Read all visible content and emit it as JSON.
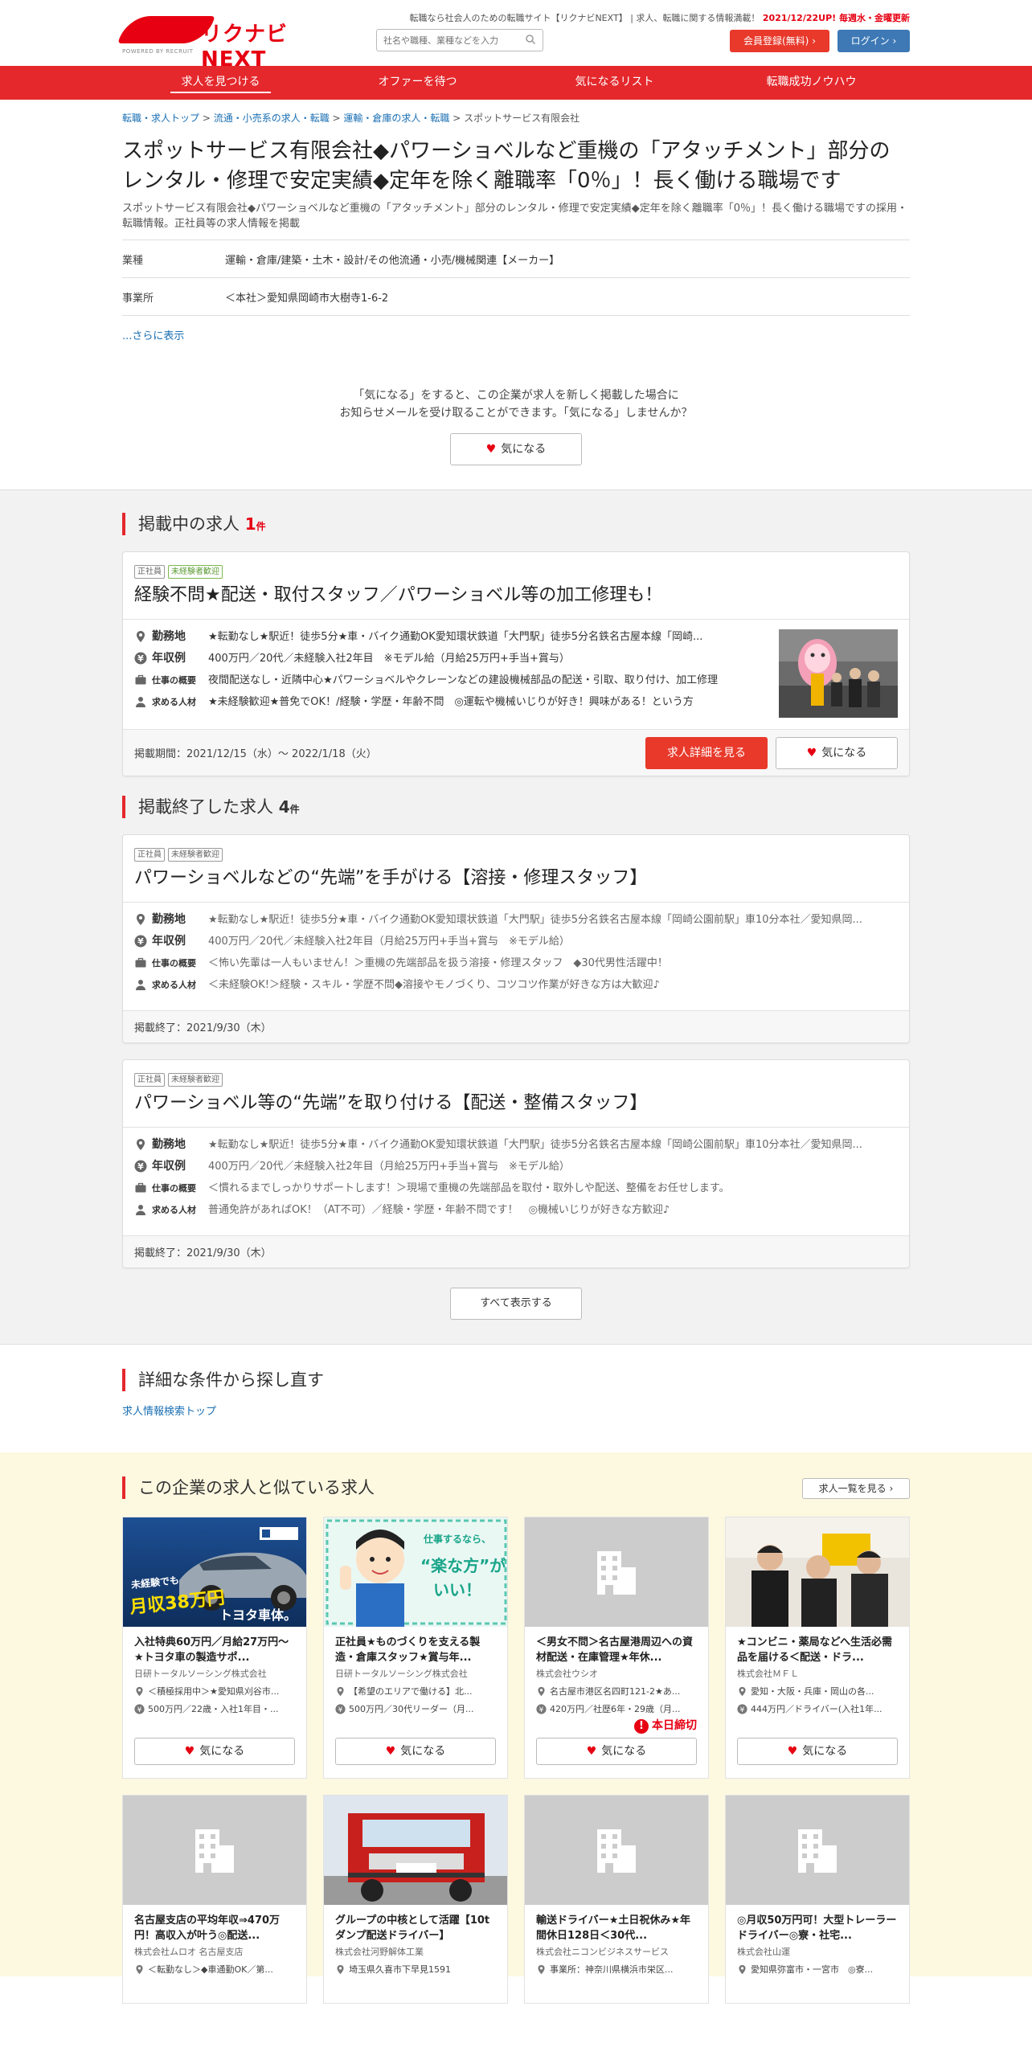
{
  "header": {
    "logo_text": "リクナビNEXT",
    "logo_sub": "POWERED BY RECRUIT",
    "tagline": "転職なら社会人のための転職サイト【リクナビNEXT】 | 求人、転職に関する情報満載！",
    "update_note": "2021/12/22UP! 毎週水・金曜更新",
    "search_placeholder": "社名や職種、業種などを入力",
    "register_label": "会員登録(無料)",
    "login_label": "ログイン"
  },
  "nav": [
    "求人を見つける",
    "オファーを待つ",
    "気になるリスト",
    "転職成功ノウハウ"
  ],
  "breadcrumb": {
    "items": [
      "転職・求人トップ",
      "流通・小売系の求人・転職",
      "運輸・倉庫の求人・転職"
    ],
    "current": "スポットサービス有限会社",
    "sep": " > "
  },
  "company": {
    "title": "スポットサービス有限会社◆パワーショベルなど重機の「アタッチメント」部分のレンタル・修理で安定実績◆定年を除く離職率「0％」！長く働ける職場です",
    "subtitle": "スポットサービス有限会社◆パワーショベルなど重機の「アタッチメント」部分のレンタル・修理で安定実績◆定年を除く離職率「0％」！長く働ける職場ですの採用・転職情報。正社員等の求人情報を掲載",
    "rows": [
      {
        "label": "業種",
        "value": "運輸・倉庫/建築・土木・設計/その他流通・小売/機械関連【メーカー】"
      },
      {
        "label": "事業所",
        "value": "＜本社＞愛知県岡崎市大樹寺1-6-2"
      }
    ],
    "more_label": "...さらに表示"
  },
  "fav_notice": {
    "line1": "「気になる」をすると、この企業が求人を新しく掲載した場合に",
    "line2": "お知らせメールを受け取ることができます。「気になる」しませんか？",
    "button": "気になる"
  },
  "labels": {
    "location": "勤務地",
    "salary": "年収例",
    "summary": "仕事の概要",
    "seeking": "求める人材",
    "detail_button": "求人詳細を見る",
    "fav_button": "気になる",
    "show_all": "すべて表示する",
    "count_unit": "件"
  },
  "active_jobs": {
    "heading": "掲載中の求人",
    "count": "1",
    "jobs": [
      {
        "tags": [
          "正社員",
          "未経験者歓迎"
        ],
        "title": "経験不問★配送・取付スタッフ／パワーショベル等の加工修理も！",
        "location": "★転勤なし★駅近！徒歩5分★車・バイク通勤OK愛知環状鉄道「大門駅」徒歩5分名鉄名古屋本線「岡崎...",
        "salary": "400万円／20代／未経験入社2年目　※モデル給（月給25万円+手当+賞与）",
        "summary": "夜間配送なし・近隣中心★パワーショベルやクレーンなどの建設機械部品の配送・引取、取り付け、加工修理",
        "seeking": "★未経験歓迎★普免でOK！/経験・学歴・年齢不問　◎運転や機械いじりが好き！興味がある！という方",
        "period": "掲載期間：2021/12/15（水）～ 2022/1/18（火）"
      }
    ]
  },
  "ended_jobs": {
    "heading": "掲載終了した求人",
    "count": "4",
    "jobs": [
      {
        "tags": [
          "正社員",
          "未経験者歓迎"
        ],
        "title": "パワーショベルなどの“先端”を手がける【溶接・修理スタッフ】",
        "location": "★転勤なし★駅近！徒歩5分★車・バイク通勤OK愛知環状鉄道「大門駅」徒歩5分名鉄名古屋本線「岡崎公園前駅」車10分本社／愛知県岡...",
        "salary": "400万円／20代／未経験入社2年目（月給25万円+手当+賞与　※モデル給）",
        "summary": "＜怖い先輩は一人もいません！＞重機の先端部品を扱う溶接・修理スタッフ　◆30代男性活躍中！",
        "seeking": "＜未経験OK!＞経験・スキル・学歴不問◆溶接やモノづくり、コツコツ作業が好きな方は大歓迎♪",
        "ended": "掲載終了：2021/9/30（木）"
      },
      {
        "tags": [
          "正社員",
          "未経験者歓迎"
        ],
        "title": "パワーショベル等の“先端”を取り付ける【配送・整備スタッフ】",
        "location": "★転勤なし★駅近！徒歩5分★車・バイク通勤OK愛知環状鉄道「大門駅」徒歩5分名鉄名古屋本線「岡崎公園前駅」車10分本社／愛知県岡...",
        "salary": "400万円／20代／未経験入社2年目（月給25万円+手当+賞与　※モデル給）",
        "summary": "＜慣れるまでしっかりサポートします！＞現場で重機の先端部品を取付・取外しや配送、整備をお任せします。",
        "seeking": "普通免許があればOK！（AT不可）／経験・学歴・年齢不問です！　◎機械いじりが好きな方歓迎♪",
        "ended": "掲載終了：2021/9/30（木）"
      }
    ]
  },
  "search_again": {
    "heading": "詳細な条件から探し直す",
    "link": "求人情報検索トップ"
  },
  "similar": {
    "heading": "この企業の求人と似ている求人",
    "list_button": "求人一覧を見る",
    "banner1": {
      "line1": "未経験でも",
      "line2": "月収38万円",
      "line3": "トヨタ車体。"
    },
    "banner2": {
      "line1": "仕事するなら、",
      "line2": "“楽な方”が",
      "line3": "いい！"
    },
    "deadline_label": "本日締切",
    "cards": [
      {
        "title": "入社特典60万円／月給27万円～★トヨタ車の製造サポ...",
        "company": "日研トータルソーシング株式会社",
        "location": "＜積極採用中＞★愛知県刈谷市...",
        "salary": "500万円／22歳・入社1年目・...",
        "deadline": false
      },
      {
        "title": "正社員★ものづくりを支える製造・倉庫スタッフ★賞与年...",
        "company": "日研トータルソーシング株式会社",
        "location": "【希望のエリアで働ける】北...",
        "salary": "500万円／30代リーダー（月...",
        "deadline": false
      },
      {
        "title": "＜男女不問＞名古屋港周辺への資材配送・在庫管理★年休...",
        "company": "株式会社ウシオ",
        "location": "名古屋市港区名四町121-2★あ...",
        "salary": "420万円／社歴6年・29歳（月...",
        "deadline": true
      },
      {
        "title": "★コンビニ・薬局などへ生活必需品を届ける＜配送・ドラ...",
        "company": "株式会社ＭＦＬ",
        "location": "愛知・大阪・兵庫・岡山の各...",
        "salary": "444万円／ドライバー(入社1年...",
        "deadline": false
      },
      {
        "title": "名古屋支店の平均年収⇒470万円！高収入が叶う◎配送...",
        "company": "株式会社ムロオ 名古屋支店",
        "location": "＜転勤なし＞◆車通勤OK／第...",
        "salary": "",
        "deadline": false
      },
      {
        "title": "グループの中核として活躍【10tダンプ配送ドライバー】",
        "company": "株式会社河野解体工業",
        "location": "埼玉県久喜市下早見1591",
        "salary": "",
        "deadline": false
      },
      {
        "title": "輸送ドライバー★土日祝休み★年間休日128日＜30代...",
        "company": "株式会社ニコンビジネスサービス",
        "location": "事業所：神奈川県横浜市栄区...",
        "salary": "",
        "deadline": false
      },
      {
        "title": "◎月収50万円可！大型トレーラードライバー◎寮・社宅...",
        "company": "株式会社山運",
        "location": "愛知県弥富市・一宮市　◎寮...",
        "salary": "",
        "deadline": false
      }
    ]
  },
  "colors": {
    "brand_red": "#e4282c",
    "link_blue": "#1a6fb3",
    "login_blue": "#3e79b6",
    "similar_bg": "#fdf9e1"
  }
}
